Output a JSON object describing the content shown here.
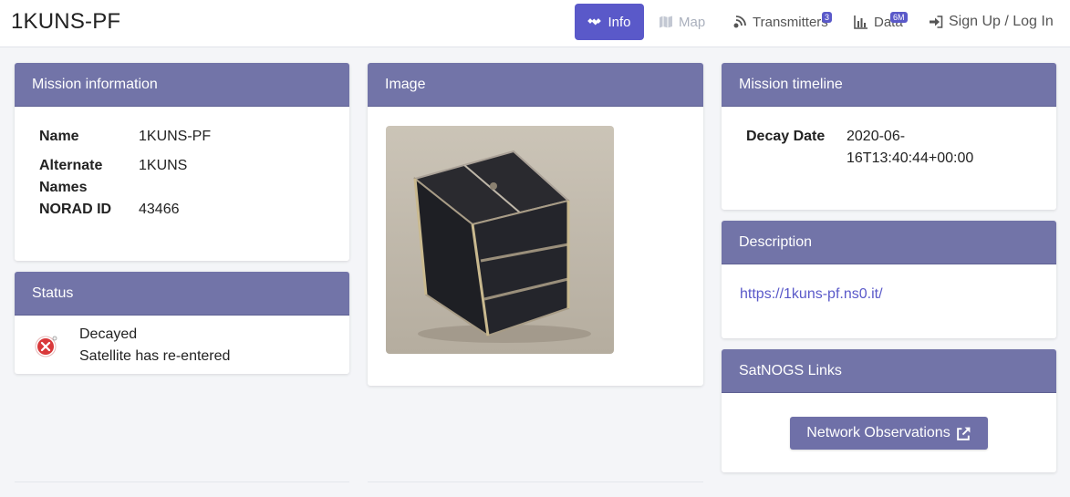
{
  "header": {
    "title": "1KUNS-PF",
    "nav": {
      "info": "Info",
      "map": "Map",
      "transmitters": "Transmitters",
      "transmitters_badge": "3",
      "data": "Data",
      "data_badge": "6M",
      "login": "Sign Up / Log In"
    }
  },
  "mission_info": {
    "title": "Mission information",
    "name_label": "Name",
    "name_value": "1KUNS-PF",
    "alt_label_1": "Alternate",
    "alt_label_2": "Names",
    "alt_value": "1KUNS",
    "norad_label": "NORAD ID",
    "norad_value": "43466"
  },
  "status": {
    "title": "Status",
    "state": "Decayed",
    "detail": "Satellite has re-entered",
    "icon": "decayed-x-icon"
  },
  "image": {
    "title": "Image"
  },
  "timeline": {
    "title": "Mission timeline",
    "decay_label": "Decay Date",
    "decay_value_1": "2020-06-",
    "decay_value_2": "16T13:40:44+00:00"
  },
  "description": {
    "title": "Description",
    "link": "https://1kuns-pf.ns0.it/"
  },
  "links": {
    "title": "SatNOGS Links",
    "network_button": "Network Observations"
  },
  "colors": {
    "accent": "#5a59c9",
    "card_header": "#7274a8",
    "button": "#6f70a8",
    "error_red": "#d9383a"
  }
}
